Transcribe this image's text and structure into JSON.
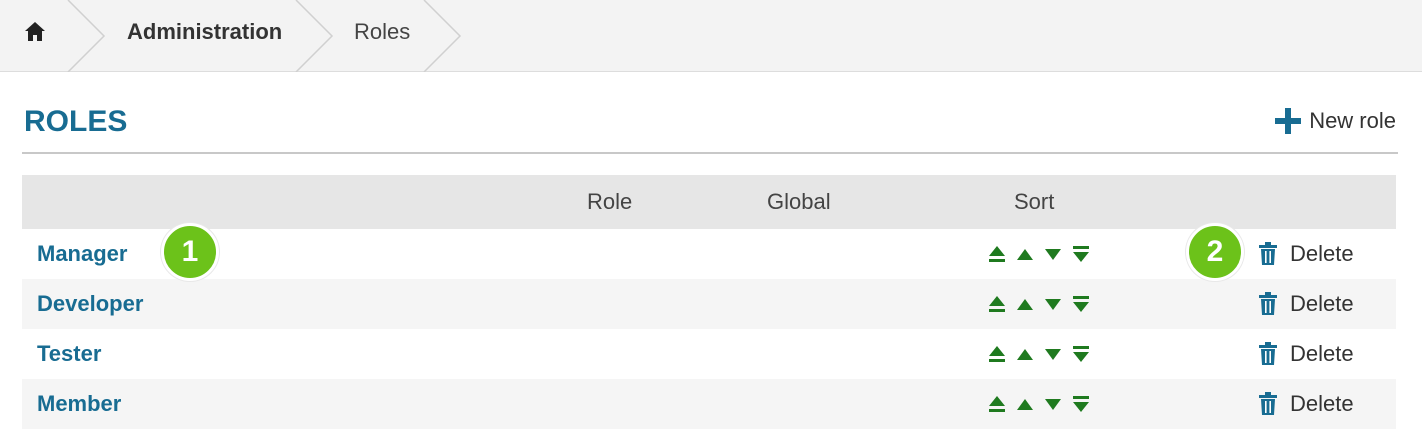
{
  "breadcrumb": {
    "home_icon": "home-icon",
    "items": [
      "Administration",
      "Roles"
    ]
  },
  "page": {
    "title": "ROLES",
    "new_role_label": "New role",
    "new_role_icon": "plus-icon"
  },
  "table": {
    "columns": [
      "",
      "Role",
      "Global",
      "Sort",
      ""
    ],
    "rows": [
      {
        "name": "Manager",
        "delete_label": "Delete"
      },
      {
        "name": "Developer",
        "delete_label": "Delete"
      },
      {
        "name": "Tester",
        "delete_label": "Delete"
      },
      {
        "name": "Member",
        "delete_label": "Delete"
      }
    ],
    "sort_icons": [
      "move-to-top-icon",
      "move-up-icon",
      "move-down-icon",
      "move-to-bottom-icon"
    ]
  },
  "callouts": [
    "1",
    "2"
  ],
  "colors": {
    "accent": "#186c92",
    "sort_green": "#1f7a1f",
    "badge_green": "#6cc21a"
  }
}
